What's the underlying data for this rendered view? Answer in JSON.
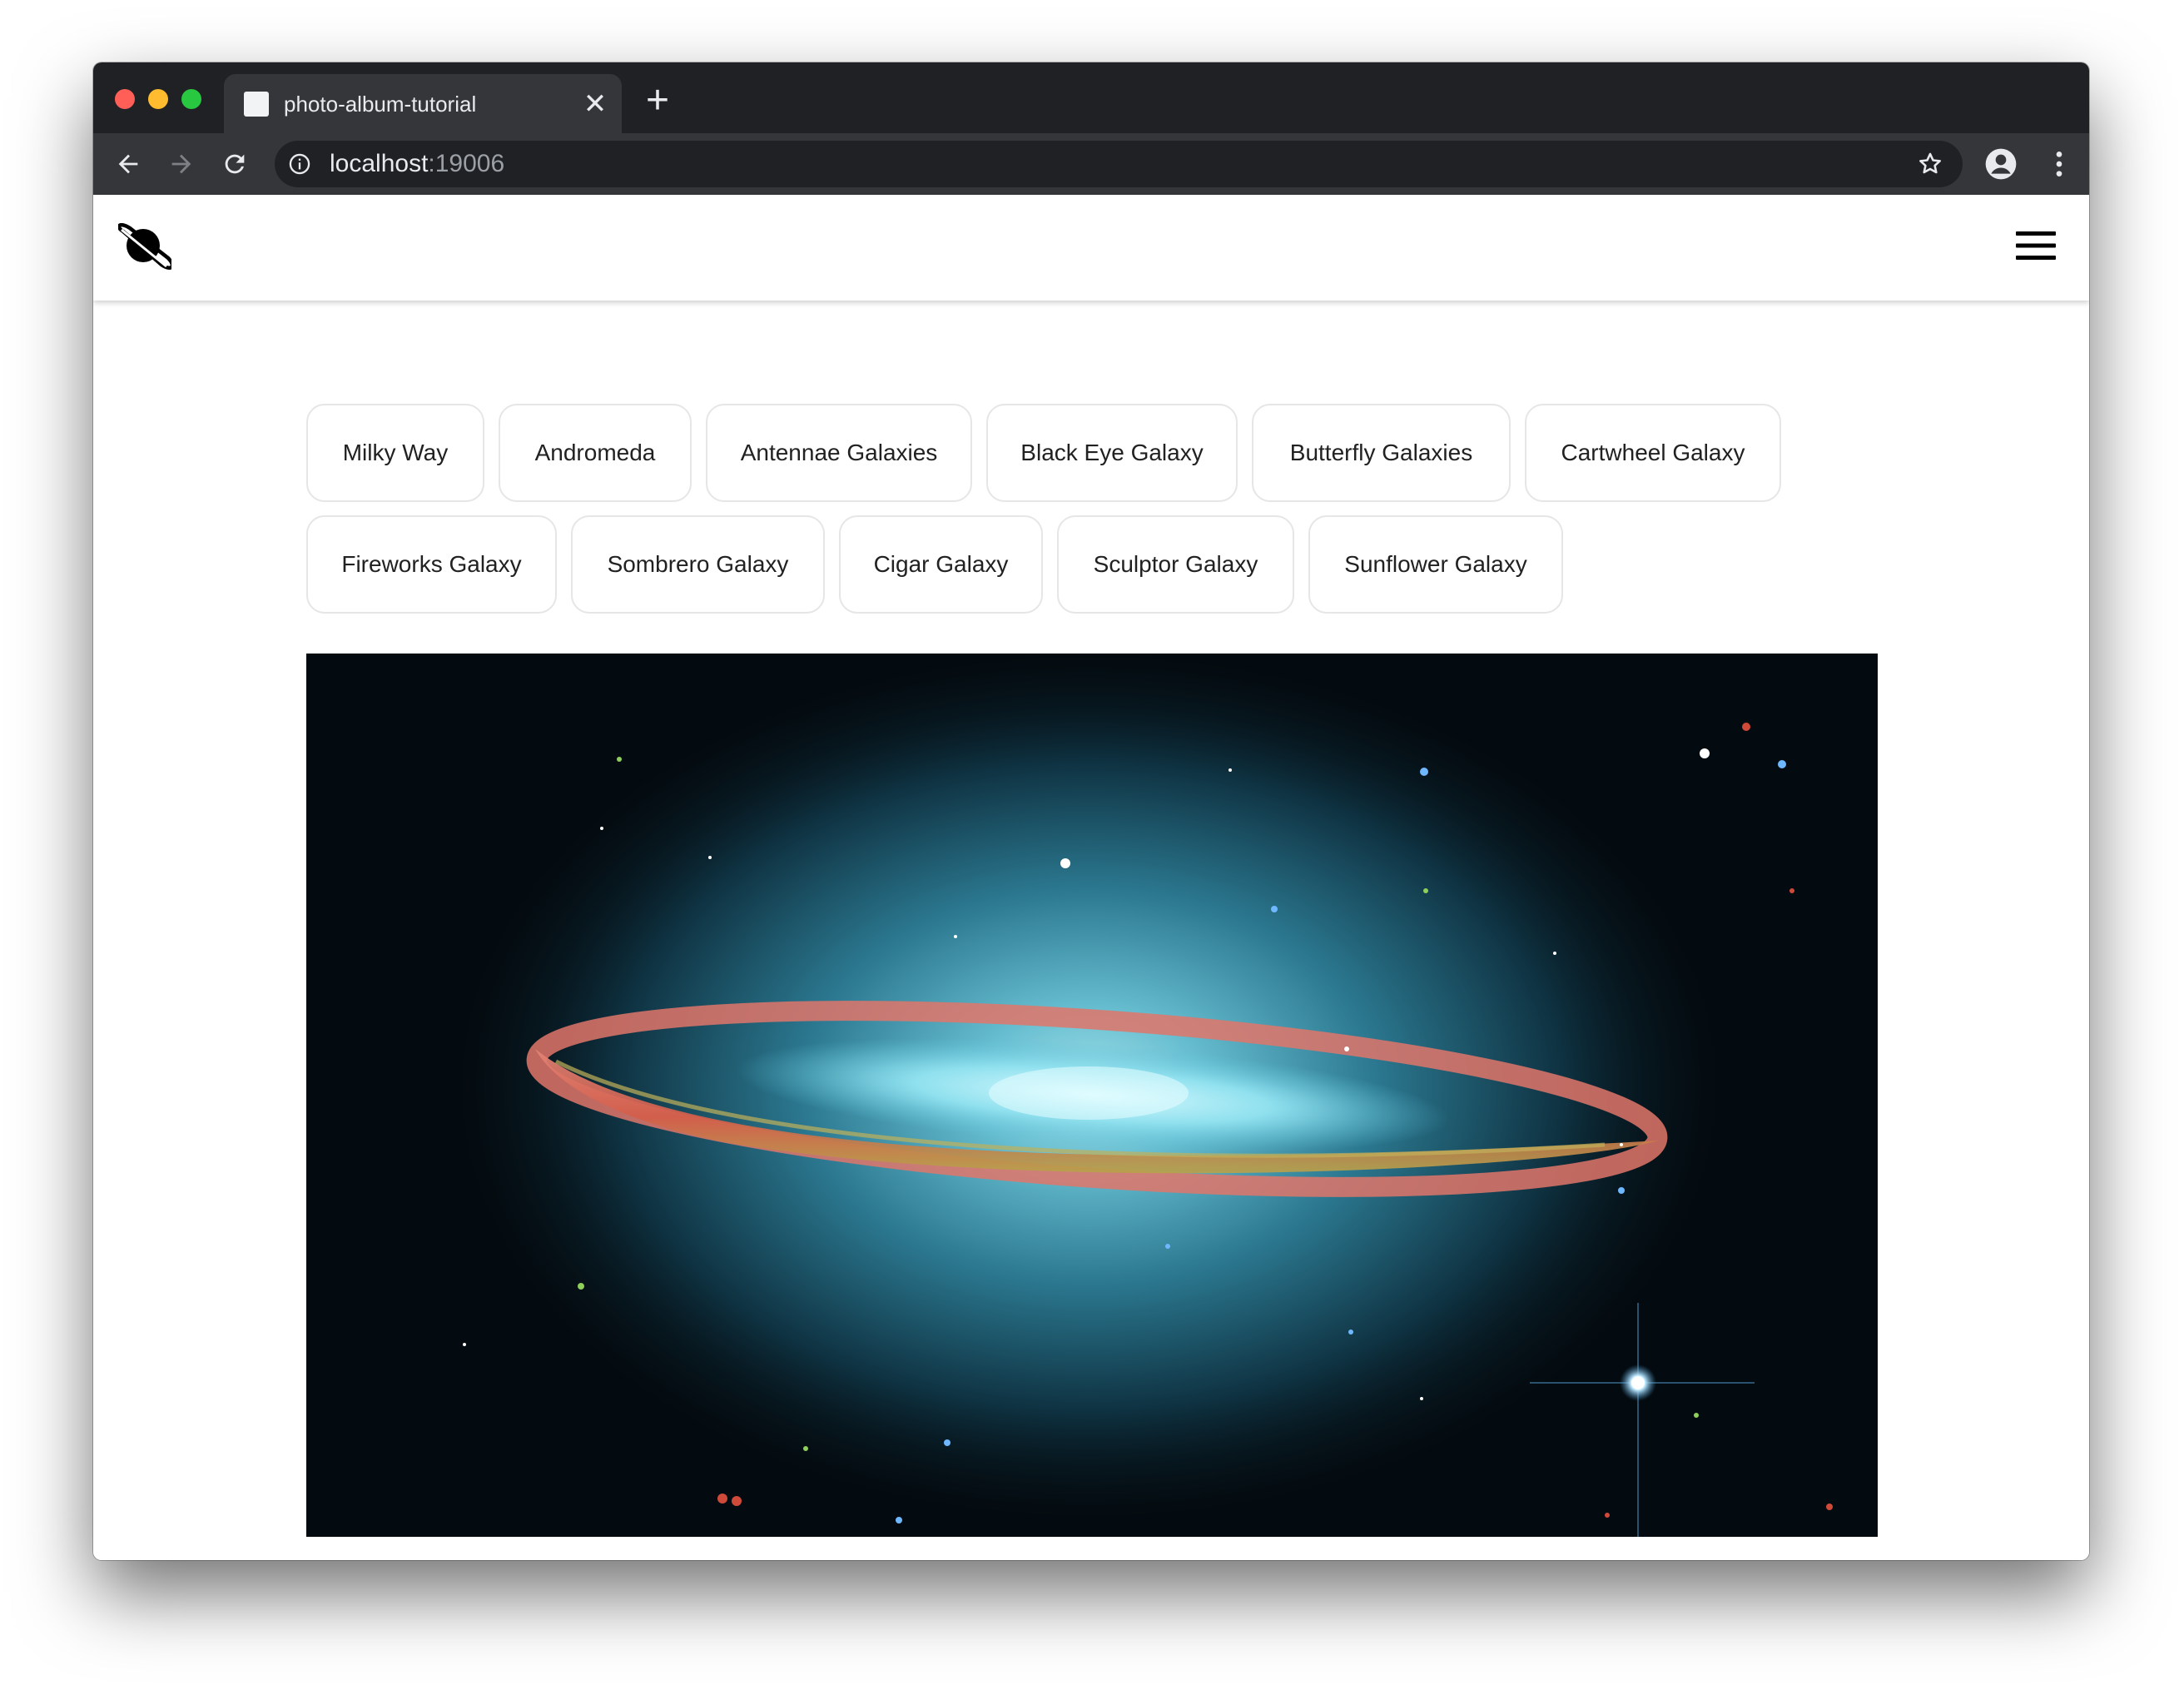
{
  "browser": {
    "tab_title": "photo-album-tutorial",
    "url_host": "localhost",
    "url_port": ":19006",
    "new_tab_symbol": "+",
    "close_symbol": "✕"
  },
  "app": {
    "logo_icon": "planet-icon",
    "menu_icon": "hamburger-menu-icon",
    "galaxies": [
      "Milky Way",
      "Andromeda",
      "Antennae Galaxies",
      "Black Eye Galaxy",
      "Butterfly Galaxies",
      "Cartwheel Galaxy",
      "Fireworks Galaxy",
      "Sombrero Galaxy",
      "Cigar Galaxy",
      "Sculptor Galaxy",
      "Sunflower Galaxy"
    ]
  },
  "colors": {
    "chrome_dark": "#202124",
    "chrome_toolbar": "#35363a",
    "chip_border": "#e6e6e6",
    "galaxy_glow": "#7fd3e6",
    "galaxy_ring": "#e0705e"
  }
}
